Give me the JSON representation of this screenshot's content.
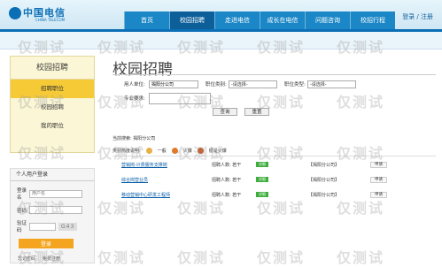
{
  "header": {
    "logo": "中国电信",
    "logo_sub": "CHINA TELECOM",
    "nav": [
      "首页",
      "校园招聘",
      "走进电信",
      "成长在电信",
      "问题咨询",
      "校招行程"
    ],
    "login_links": "登录 / 注册"
  },
  "sidebar": {
    "title": "校园招聘",
    "items": [
      "招聘职位",
      "校园招聘",
      "我的职位"
    ]
  },
  "login": {
    "title": "个人用户登录",
    "user_label": "登录名",
    "user_placeholder": "用户名",
    "pass_label": "密码",
    "captcha_label": "验证码",
    "captcha_text": "G43",
    "button": "登录",
    "forgot": "忘记密码",
    "register": "免费注册"
  },
  "main": {
    "title": "校园招聘",
    "form": {
      "unit_label": "用人单位:",
      "unit_value": "揭阳分公司",
      "category_label": "职位类别:",
      "category_value": "-请选择-",
      "type_label": "职位类型:",
      "type_value": "-请选择-",
      "major_label": "专业要求:",
      "search_button": "查询",
      "reset_button": "重置"
    },
    "current": "当前搜索: 揭阳分公司",
    "legend": {
      "prefix": "类别热度说明:",
      "items": [
        "一般",
        "火爆",
        "很是火爆"
      ]
    },
    "rows": [
      {
        "title": "营销岗-计费服务支撑岗",
        "count": "招聘人数: 若干",
        "tag": "详细",
        "company": "【揭阳分公司】",
        "apply": "申请"
      },
      {
        "title": "综合岗营业员",
        "count": "招聘人数: 若干",
        "tag": "详细",
        "company": "【揭阳分公司】",
        "apply": "申请"
      },
      {
        "title": "移动营销中心研发工程师",
        "count": "招聘人数: 若干",
        "tag": "详细",
        "company": "【揭阳分公司】",
        "apply": "申请"
      }
    ]
  },
  "watermark": "仅测试",
  "colors": {
    "brand": "#0b6fb6",
    "accent": "#f6ca36",
    "tag": "#3fae3f"
  }
}
